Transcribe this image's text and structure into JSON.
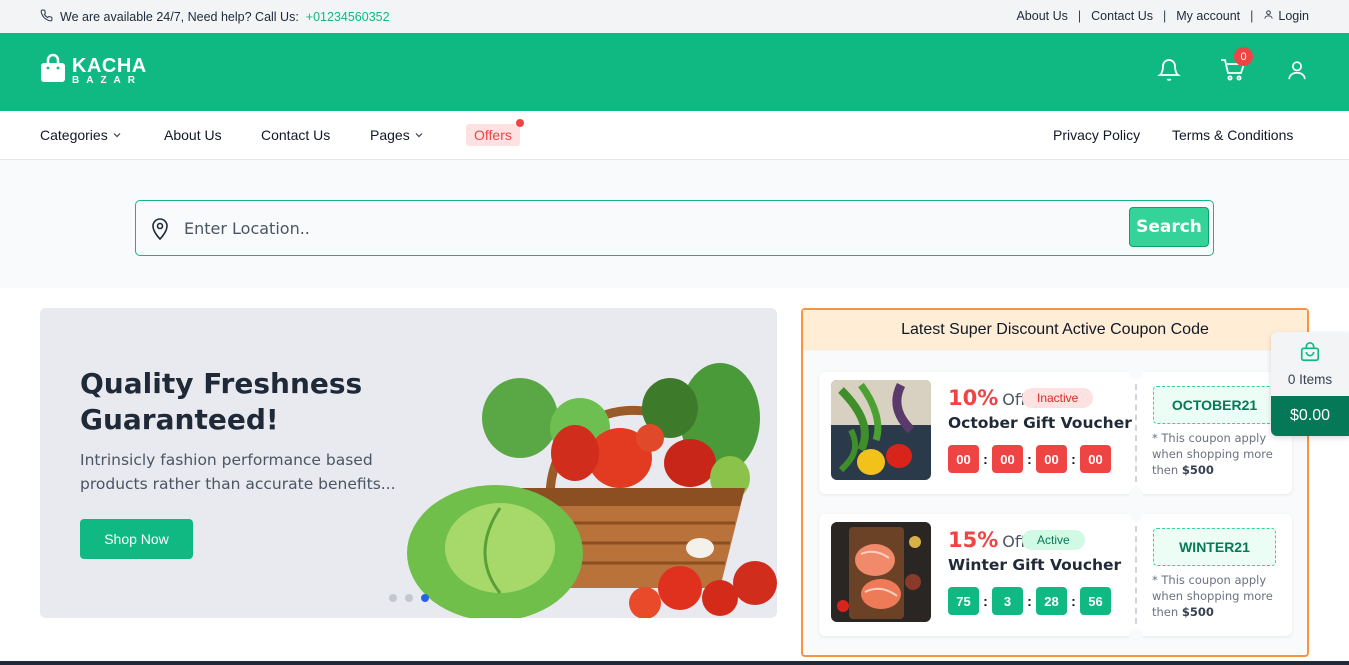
{
  "topbar": {
    "help_text": "We are available 24/7, Need help? Call Us:",
    "phone": "+01234560352",
    "links": [
      "About Us",
      "Contact Us",
      "My account"
    ],
    "login": "Login"
  },
  "header": {
    "logo_line1": "KACHA",
    "logo_line2": "BAZAR",
    "cart_count": "0"
  },
  "nav": {
    "categories": "Categories",
    "about": "About Us",
    "contact": "Contact Us",
    "pages": "Pages",
    "offers": "Offers",
    "privacy": "Privacy Policy",
    "terms": "Terms & Conditions"
  },
  "search": {
    "placeholder": "Enter Location..",
    "button": "Search"
  },
  "hero": {
    "title": "Quality Freshness Guaranteed!",
    "subtitle": "Intrinsicly fashion performance based products rather than accurate benefits...",
    "button": "Shop Now",
    "active_slide": 3
  },
  "coupons": {
    "heading": "Latest Super Discount Active Coupon Code",
    "items": [
      {
        "percent": "10%",
        "off": "Off",
        "status": "Inactive",
        "name": "October Gift Voucher",
        "timer": [
          "00",
          "00",
          "00",
          "00"
        ],
        "code": "OCTOBER21",
        "note": "* This coupon apply when shopping more then",
        "min": "$500"
      },
      {
        "percent": "15%",
        "off": "Off",
        "status": "Active",
        "name": "Winter Gift Voucher",
        "timer": [
          "75",
          "3",
          "28",
          "56"
        ],
        "code": "WINTER21",
        "note": "* This coupon apply when shopping more then",
        "min": "$500"
      }
    ]
  },
  "float_cart": {
    "items": "0 Items",
    "total": "$0.00"
  },
  "colors": {
    "brand": "#10b981",
    "danger": "#ef4444",
    "coupon_border": "#fb923c"
  }
}
